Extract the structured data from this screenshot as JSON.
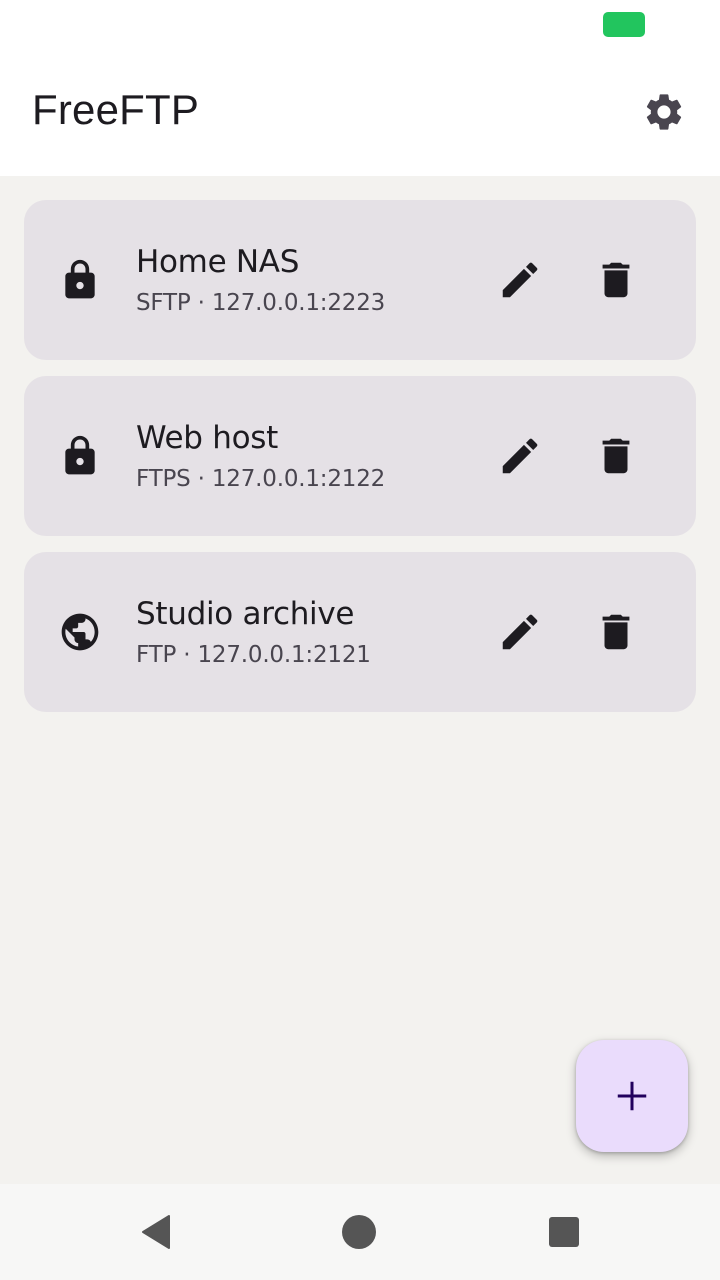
{
  "colors": {
    "app_bar_bg": "#ffffff",
    "background": "#f3f2ef",
    "card_bg": "#e5e1e6",
    "icon": "#1d1b20",
    "battery": "#22c55e",
    "fab_bg": "#eadcfc",
    "fab_icon": "#21005d",
    "nav_icon": "#555555"
  },
  "status_bar": {
    "battery_icon": "battery-icon"
  },
  "app_bar": {
    "title": "FreeFTP",
    "settings_icon": "gear-icon"
  },
  "servers": [
    {
      "name": "Home NAS",
      "subtitle": "SFTP · 127.0.0.1:2223",
      "icon": "lock-icon"
    },
    {
      "name": "Web host",
      "subtitle": "FTPS · 127.0.0.1:2122",
      "icon": "lock-icon"
    },
    {
      "name": "Studio archive",
      "subtitle": "FTP · 127.0.0.1:2121",
      "icon": "globe-icon"
    }
  ],
  "card_actions": {
    "edit_icon": "pencil-icon",
    "delete_icon": "trash-icon"
  },
  "fab": {
    "icon": "plus-icon"
  },
  "nav_bar": {
    "back_icon": "back-triangle-icon",
    "home_icon": "home-circle-icon",
    "recents_icon": "recents-square-icon"
  }
}
